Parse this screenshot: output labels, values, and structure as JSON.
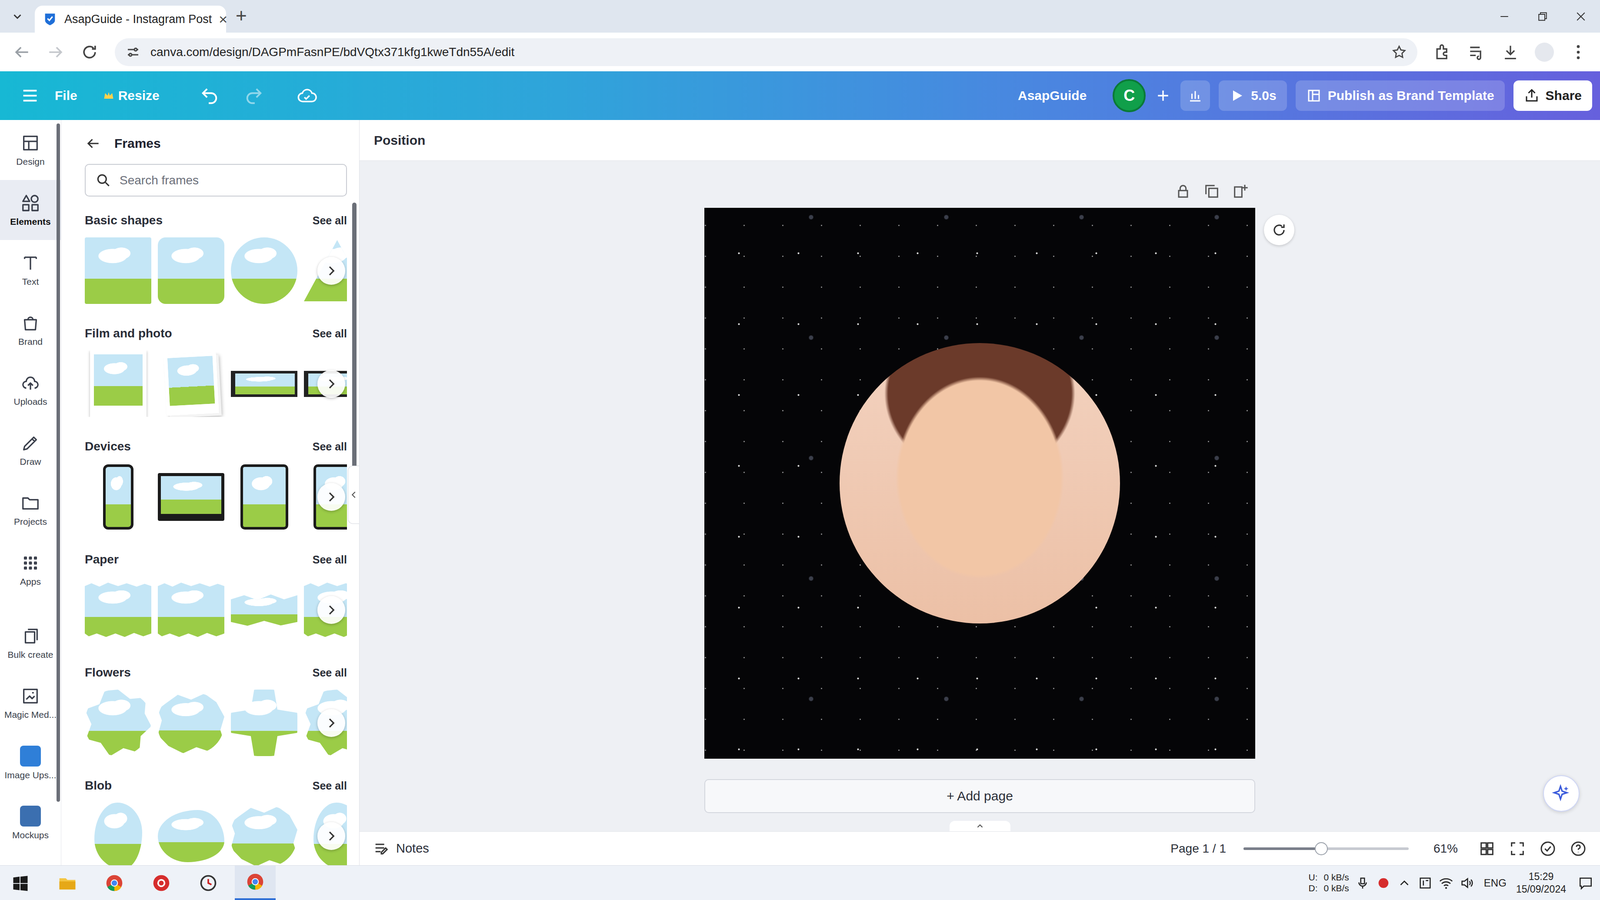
{
  "browser": {
    "tab_title": "AsapGuide - Instagram Post",
    "tab_close": "×",
    "new_tab": "+",
    "url": "canva.com/design/DAGPmFasnPE/bdVQtx371kfg1kweTdn55A/edit"
  },
  "toolbar": {
    "menu": [
      "File",
      "Resize"
    ],
    "design_name": "AsapGuide",
    "avatar": "C",
    "play_duration": "5.0s",
    "publish": "Publish as Brand Template",
    "share": "Share"
  },
  "rail": [
    {
      "label": "Design",
      "kind": "icon",
      "selected": false
    },
    {
      "label": "Elements",
      "kind": "icon",
      "selected": true
    },
    {
      "label": "Text",
      "kind": "icon",
      "selected": false
    },
    {
      "label": "Brand",
      "kind": "icon",
      "selected": false
    },
    {
      "label": "Uploads",
      "kind": "icon",
      "selected": false
    },
    {
      "label": "Draw",
      "kind": "icon",
      "selected": false
    },
    {
      "label": "Projects",
      "kind": "icon",
      "selected": false
    },
    {
      "label": "Apps",
      "kind": "icon",
      "selected": false
    },
    {
      "label": "Bulk create",
      "kind": "icon",
      "selected": false
    },
    {
      "label": "Magic Med...",
      "kind": "icon",
      "selected": false
    },
    {
      "label": "Image Ups...",
      "kind": "app",
      "selected": false
    },
    {
      "label": "Mockups",
      "kind": "app",
      "selected": false
    }
  ],
  "panel": {
    "title": "Frames",
    "search_placeholder": "Search frames",
    "sections": [
      {
        "title": "Basic shapes",
        "see_all": "See all",
        "tiles": [
          {
            "kind": "rect"
          },
          {
            "kind": "rounded"
          },
          {
            "kind": "circle"
          },
          {
            "kind": "triangle"
          }
        ]
      },
      {
        "title": "Film and photo",
        "see_all": "See all",
        "tiles": [
          {
            "kind": "polaroid"
          },
          {
            "kind": "stack"
          },
          {
            "kind": "strip"
          },
          {
            "kind": "strip"
          }
        ]
      },
      {
        "title": "Devices",
        "see_all": "See all",
        "tiles": [
          {
            "kind": "phone"
          },
          {
            "kind": "monitor"
          },
          {
            "kind": "tablet"
          },
          {
            "kind": "tablet"
          }
        ]
      },
      {
        "title": "Paper",
        "see_all": "See all",
        "tiles": [
          {
            "kind": "torn"
          },
          {
            "kind": "torn"
          },
          {
            "kind": "tornstrip"
          },
          {
            "kind": "torn"
          }
        ]
      },
      {
        "title": "Flowers",
        "see_all": "See all",
        "tiles": [
          {
            "kind": "flower"
          },
          {
            "kind": "cloud"
          },
          {
            "kind": "clover"
          },
          {
            "kind": "flower"
          }
        ]
      },
      {
        "title": "Blob",
        "see_all": "See all",
        "tiles": [
          {
            "kind": "blob"
          },
          {
            "kind": "blob2"
          },
          {
            "kind": "cloud"
          },
          {
            "kind": "blob"
          }
        ]
      }
    ]
  },
  "workspace": {
    "toolbar_label": "Position",
    "add_page": "+ Add page"
  },
  "footer": {
    "notes": "Notes",
    "page": "Page 1 / 1",
    "zoom": "61%",
    "zoom_level": 0.47
  },
  "taskbar": {
    "net_up_label": "U:",
    "net_down_label": "D:",
    "net_up": "0 kB/s",
    "net_down": "0 kB/s",
    "lang": "ENG",
    "time": "15:29",
    "date": "15/09/2024"
  }
}
